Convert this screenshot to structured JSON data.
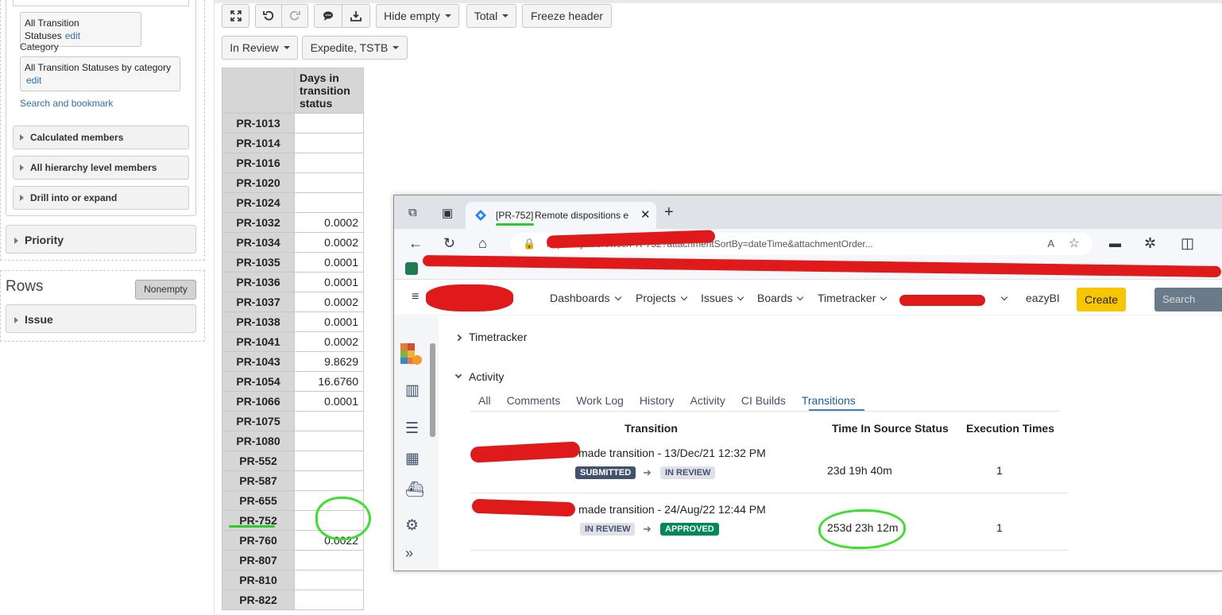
{
  "left_panel": {
    "statuses_chip": {
      "label": "All Transition Statuses",
      "edit": "edit"
    },
    "category_label": "Category",
    "category_chip": {
      "label": "All Transition Statuses by category",
      "edit": "edit"
    },
    "search_bookmark": "Search and bookmark",
    "collapsibles": [
      "Calculated members",
      "All hierarchy level members",
      "Drill into or expand"
    ],
    "priority": "Priority",
    "rows_title": "Rows",
    "nonempty": "Nonempty",
    "issue": "Issue"
  },
  "toolbar": {
    "hide_empty": "Hide empty",
    "total": "Total",
    "freeze_header": "Freeze header",
    "filter_status": "In Review",
    "filter_types": "Expedite, TSTB"
  },
  "report": {
    "column_header": "Days in transition status",
    "rows": [
      {
        "key": "PR-1013",
        "value": ""
      },
      {
        "key": "PR-1014",
        "value": ""
      },
      {
        "key": "PR-1016",
        "value": ""
      },
      {
        "key": "PR-1020",
        "value": ""
      },
      {
        "key": "PR-1024",
        "value": ""
      },
      {
        "key": "PR-1032",
        "value": "0.0002"
      },
      {
        "key": "PR-1034",
        "value": "0.0002"
      },
      {
        "key": "PR-1035",
        "value": "0.0001"
      },
      {
        "key": "PR-1036",
        "value": "0.0001"
      },
      {
        "key": "PR-1037",
        "value": "0.0002"
      },
      {
        "key": "PR-1038",
        "value": "0.0001"
      },
      {
        "key": "PR-1041",
        "value": "0.0002"
      },
      {
        "key": "PR-1043",
        "value": "9.8629"
      },
      {
        "key": "PR-1054",
        "value": "16.6760"
      },
      {
        "key": "PR-1066",
        "value": "0.0001"
      },
      {
        "key": "PR-1075",
        "value": ""
      },
      {
        "key": "PR-1080",
        "value": ""
      },
      {
        "key": "PR-552",
        "value": ""
      },
      {
        "key": "PR-587",
        "value": ""
      },
      {
        "key": "PR-655",
        "value": ""
      },
      {
        "key": "PR-752",
        "value": ""
      },
      {
        "key": "PR-760",
        "value": "0.0022"
      },
      {
        "key": "PR-807",
        "value": ""
      },
      {
        "key": "PR-810",
        "value": ""
      },
      {
        "key": "PR-822",
        "value": ""
      }
    ]
  },
  "browser": {
    "tab_key": "[PR-752]",
    "tab_title": "Remote dispositions en",
    "url": "https://              /jira/browse/PR-752?attachmentSortBy=dateTime&attachmentOrder...",
    "nav": {
      "dashboards": "Dashboards",
      "projects": "Projects",
      "issues": "Issues",
      "boards": "Boards",
      "timetracker": "Timetracker",
      "eazybi": "eazyBI",
      "create": "Create",
      "search_placeholder": "Search"
    },
    "sections": {
      "timetracker": "Timetracker",
      "activity": "Activity"
    },
    "tabs": [
      "All",
      "Comments",
      "Work Log",
      "History",
      "Activity",
      "CI Builds",
      "Transitions"
    ],
    "table_headers": {
      "transition": "Transition",
      "time": "Time In Source Status",
      "exec": "Execution Times"
    },
    "transitions": [
      {
        "made": "made transition - 13/Dec/21 12:32 PM",
        "from": "SUBMITTED",
        "to": "IN REVIEW",
        "time": "23d 19h 40m",
        "exec": "1"
      },
      {
        "made": "made transition - 24/Aug/22 12:44 PM",
        "from": "IN REVIEW",
        "to": "APPROVED",
        "time": "253d 23h 12m",
        "exec": "1"
      }
    ]
  },
  "colors": {
    "accent_link": "#2f6fb0",
    "create_button": "#f7c600",
    "approved": "#00875a",
    "submitted": "#42526e",
    "annotation_green": "#3ce02e",
    "redaction_red": "#e0191b"
  }
}
